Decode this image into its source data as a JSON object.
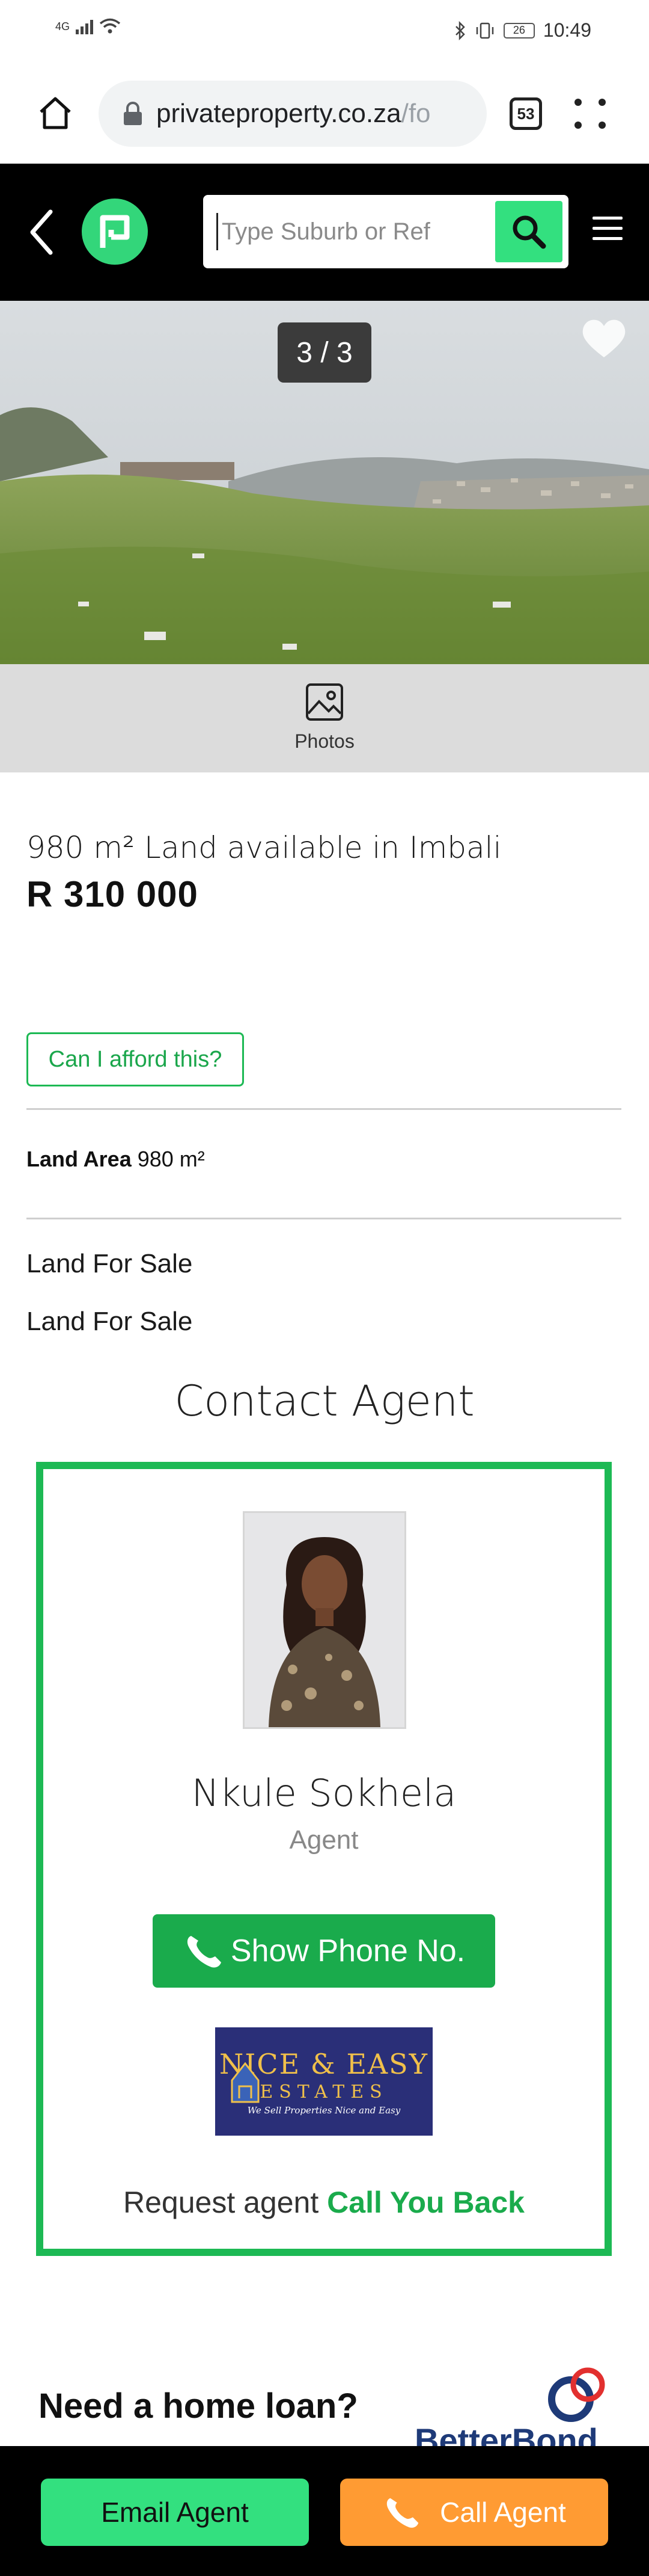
{
  "status_bar": {
    "network": "4G",
    "battery": "26",
    "time": "10:49"
  },
  "browser": {
    "url_main": "privateproperty.co.za",
    "url_rest": "/fo",
    "tab_count": "53"
  },
  "header": {
    "search_placeholder": "Type Suburb or Ref"
  },
  "gallery": {
    "counter": "3 / 3",
    "photos_label": "Photos"
  },
  "listing": {
    "title": "980 m² Land available in Imbali",
    "price": "R 310 000",
    "afford_label": "Can I afford this?",
    "land_area_label": "Land Area",
    "land_area_value": "980 m²",
    "type_line_1": "Land For Sale",
    "type_line_2": "Land For Sale"
  },
  "contact": {
    "heading": "Contact Agent",
    "agent_name": "Nkule Sokhela",
    "agent_role": "Agent",
    "phone_button": "Show Phone No.",
    "agency_line1": "NICE & EASY",
    "agency_line2": "ESTATES",
    "agency_tagline": "We Sell Properties Nice and Easy",
    "callback_prefix": "Request agent",
    "callback_link": "Call You Back"
  },
  "loan": {
    "title": "Need a home loan?",
    "brand": "BetterBond"
  },
  "actions": {
    "email_label": "Email Agent",
    "call_label": "Call Agent"
  },
  "colors": {
    "brand_green": "#33e07f",
    "accent_green": "#1aab4c",
    "call_orange": "#ff9b33"
  }
}
